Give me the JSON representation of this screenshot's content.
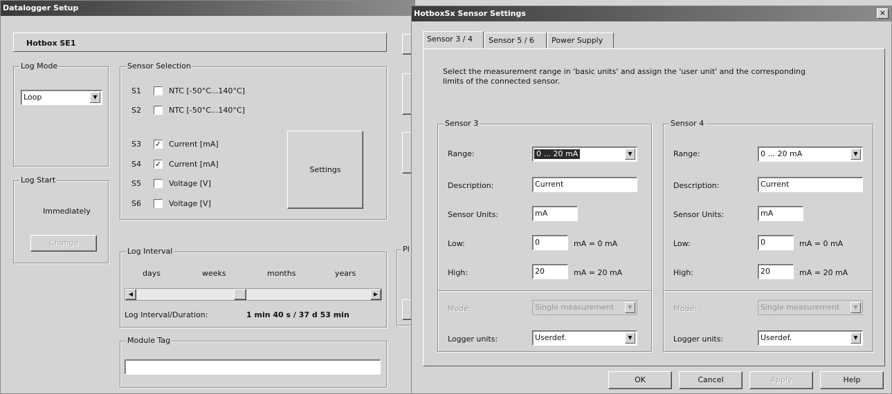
{
  "left": {
    "title": "Datalogger Setup",
    "device_name": "Hotbox SE1",
    "log_mode": {
      "legend": "Log Mode",
      "value": "Loop"
    },
    "sensor_selection": {
      "legend": "Sensor Selection",
      "items": [
        {
          "id": "S1",
          "label": "NTC [-50°C...140°C]",
          "checked": ""
        },
        {
          "id": "S2",
          "label": "NTC [-50°C...140°C]",
          "checked": ""
        },
        {
          "id": "S3",
          "label": "Current [mA]",
          "checked": "✓"
        },
        {
          "id": "S4",
          "label": "Current [mA]",
          "checked": "✓"
        },
        {
          "id": "S5",
          "label": "Voltage [V]",
          "checked": ""
        },
        {
          "id": "S6",
          "label": "Voltage [V]",
          "checked": ""
        }
      ],
      "settings_button": "Settings"
    },
    "log_start": {
      "legend": "Log Start",
      "value": "Immediately",
      "change_button": "Change"
    },
    "log_interval": {
      "legend": "Log Interval",
      "scale": [
        "days",
        "weeks",
        "months",
        "years"
      ],
      "duration_label": "Log Interval/Duration:",
      "duration_value": "1 min 40 s / 37 d 53 min",
      "slider_position": 0.44
    },
    "module_tag": {
      "legend": "Module Tag",
      "value": ""
    },
    "edge_text": "Pl"
  },
  "right": {
    "title": "HotboxSx Sensor Settings",
    "close": "×",
    "tabs": [
      "Sensor 3 / 4",
      "Sensor 5 / 6",
      "Power Supply"
    ],
    "instructions_1": "Select the measurement range in 'basic units' and assign the 'user unit' and the corresponding",
    "instructions_2": "limits of the connected sensor.",
    "labels": {
      "range": "Range:",
      "description": "Description:",
      "sensor_units": "Sensor Units:",
      "low": "Low:",
      "high": "High:",
      "mode": "Mode:",
      "logger_units": "Logger units:"
    },
    "sensor3": {
      "legend": "Sensor 3",
      "range": "0 ... 20 mA",
      "description": "Current",
      "sensor_units": "mA",
      "low": "0",
      "low_suffix": "mA = 0 mA",
      "high": "20",
      "high_suffix": "mA = 20 mA",
      "mode": "Single measurement",
      "logger_units": "Userdef."
    },
    "sensor4": {
      "legend": "Sensor 4",
      "range": "0 ... 20 mA",
      "description": "Current",
      "sensor_units": "mA",
      "low": "0",
      "low_suffix": "mA = 0 mA",
      "high": "20",
      "high_suffix": "mA = 20 mA",
      "mode": "Single measurement",
      "logger_units": "Userdef."
    },
    "buttons": {
      "ok": "OK",
      "cancel": "Cancel",
      "apply": "Apply",
      "help": "Help"
    }
  }
}
